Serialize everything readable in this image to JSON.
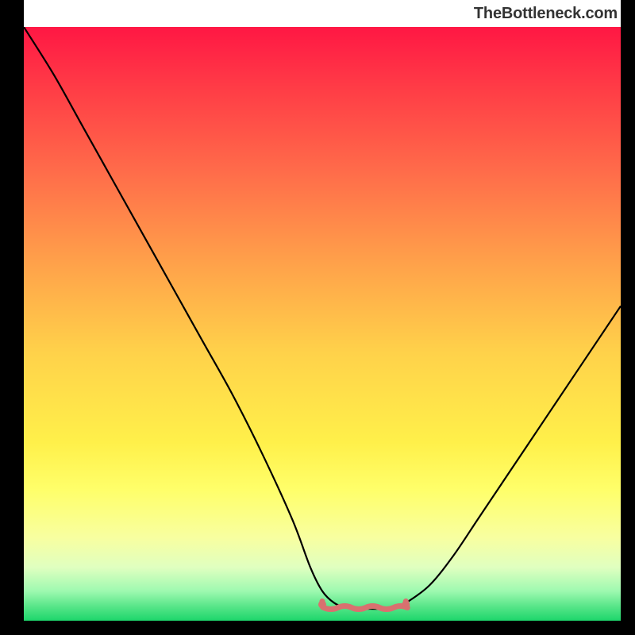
{
  "caption": {
    "text": "TheBottleneck.com"
  },
  "chart_data": {
    "type": "line",
    "title": "",
    "xlabel": "",
    "ylabel": "",
    "xlim": [
      0,
      100
    ],
    "ylim": [
      0,
      100
    ],
    "x": [
      0,
      5,
      10,
      15,
      20,
      25,
      30,
      35,
      40,
      45,
      48,
      50,
      52,
      54,
      56,
      58,
      60,
      62,
      64,
      68,
      72,
      76,
      80,
      84,
      88,
      92,
      96,
      100
    ],
    "series": [
      {
        "name": "bottleneck-curve",
        "values": [
          100,
          92,
          83,
          74,
          65,
          56,
          47,
          38,
          28,
          17,
          9,
          5,
          3,
          2.2,
          2,
          2,
          2,
          2.2,
          3,
          6,
          11,
          17,
          23,
          29,
          35,
          41,
          47,
          53
        ]
      }
    ],
    "flat_region": {
      "x_start": 50,
      "x_end": 64,
      "y": 2.2
    },
    "background_gradient": {
      "stops": [
        {
          "offset": 0.0,
          "color": "#FF1744"
        },
        {
          "offset": 0.1,
          "color": "#FF3B46"
        },
        {
          "offset": 0.25,
          "color": "#FF6E4A"
        },
        {
          "offset": 0.4,
          "color": "#FFA24A"
        },
        {
          "offset": 0.55,
          "color": "#FFD24A"
        },
        {
          "offset": 0.7,
          "color": "#FFF04A"
        },
        {
          "offset": 0.78,
          "color": "#FFFF6A"
        },
        {
          "offset": 0.86,
          "color": "#F8FFA0"
        },
        {
          "offset": 0.91,
          "color": "#E0FFC0"
        },
        {
          "offset": 0.95,
          "color": "#9EF9B0"
        },
        {
          "offset": 0.975,
          "color": "#5AE68A"
        },
        {
          "offset": 1.0,
          "color": "#1DD66B"
        }
      ]
    },
    "curve_color": "#000000",
    "flat_marker_color": "#D9706F"
  }
}
